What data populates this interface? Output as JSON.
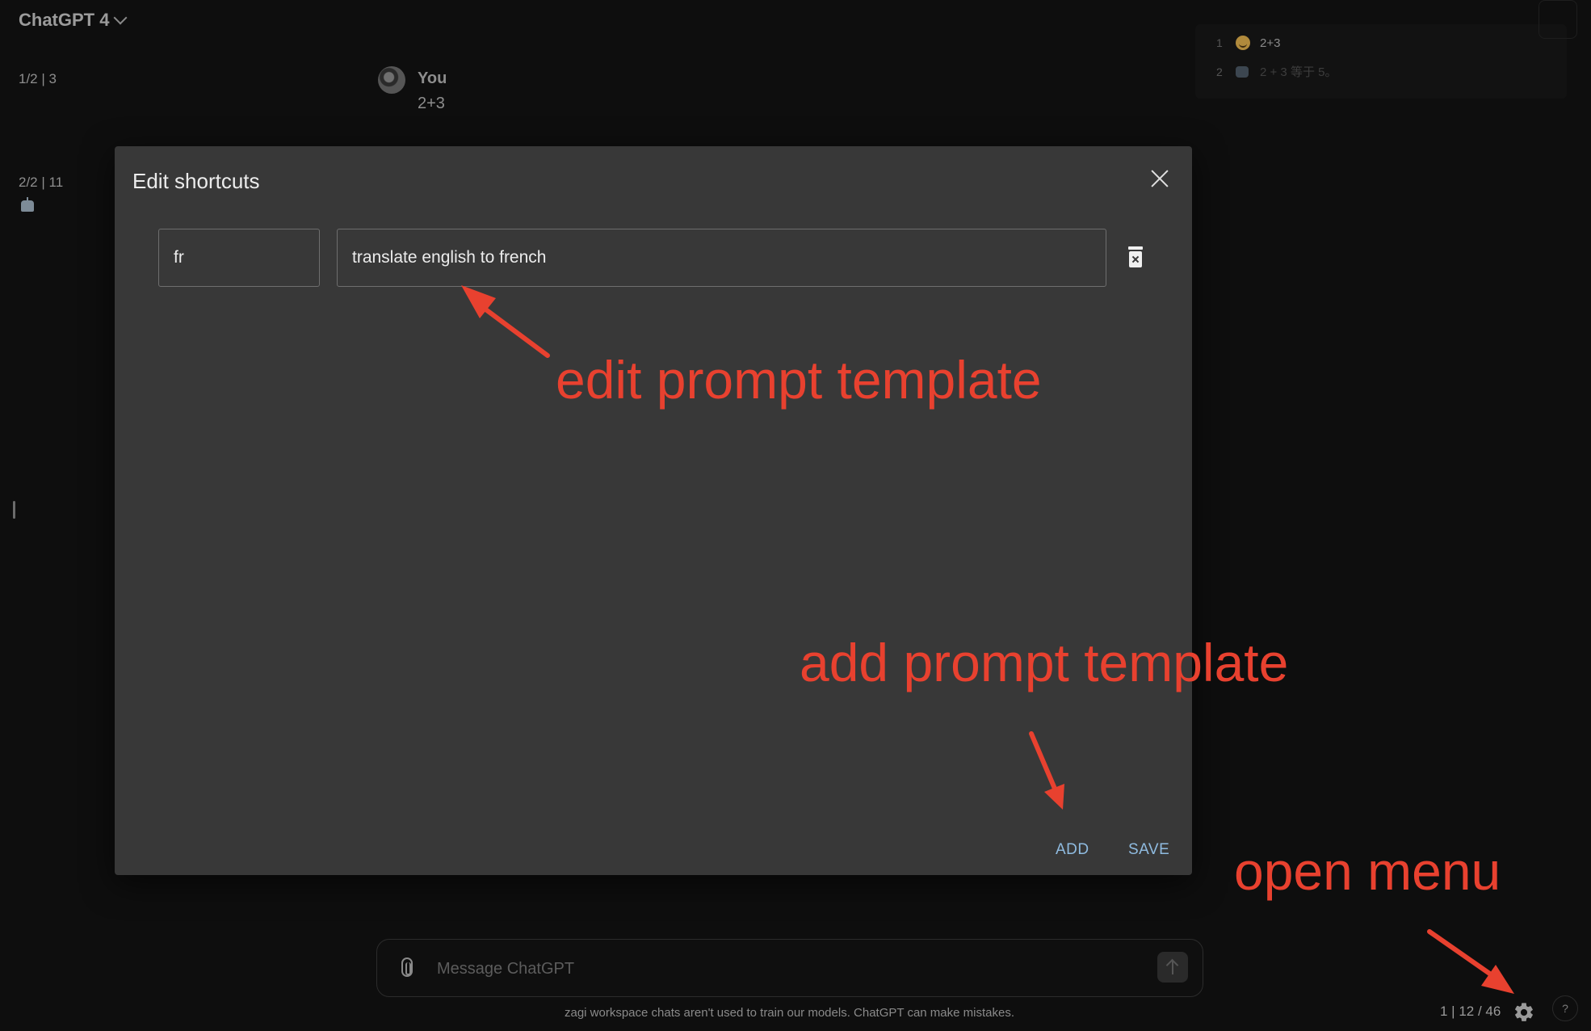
{
  "header": {
    "model_title": "ChatGPT 4"
  },
  "turns": [
    {
      "counter": "1/2 | 3"
    },
    {
      "counter": "2/2 | 11"
    }
  ],
  "message": {
    "author": "You",
    "text": "2+3"
  },
  "outline": {
    "items": [
      {
        "num": "1",
        "icon": "smile-emoji-icon",
        "text": "2+3"
      },
      {
        "num": "2",
        "icon": "robot-emoji-icon",
        "text": "2 + 3 等于 5。"
      }
    ]
  },
  "modal": {
    "title": "Edit shortcuts",
    "shortcut_key": "fr",
    "shortcut_prompt": "translate english to french",
    "add_label": "ADD",
    "save_label": "SAVE"
  },
  "composer": {
    "placeholder": "Message ChatGPT"
  },
  "footer": {
    "disclaimer": "zagi workspace chats aren't used to train our models. ChatGPT can make mistakes.",
    "stats": "1 | 12 / 46",
    "help_label": "?"
  },
  "annotations": {
    "edit": "edit prompt template",
    "add": "add prompt template",
    "open": "open menu"
  },
  "colors": {
    "annotation": "#e8412f",
    "modal_bg": "#383838",
    "page_bg": "#0e0e0e",
    "action": "#8fbbe0"
  }
}
